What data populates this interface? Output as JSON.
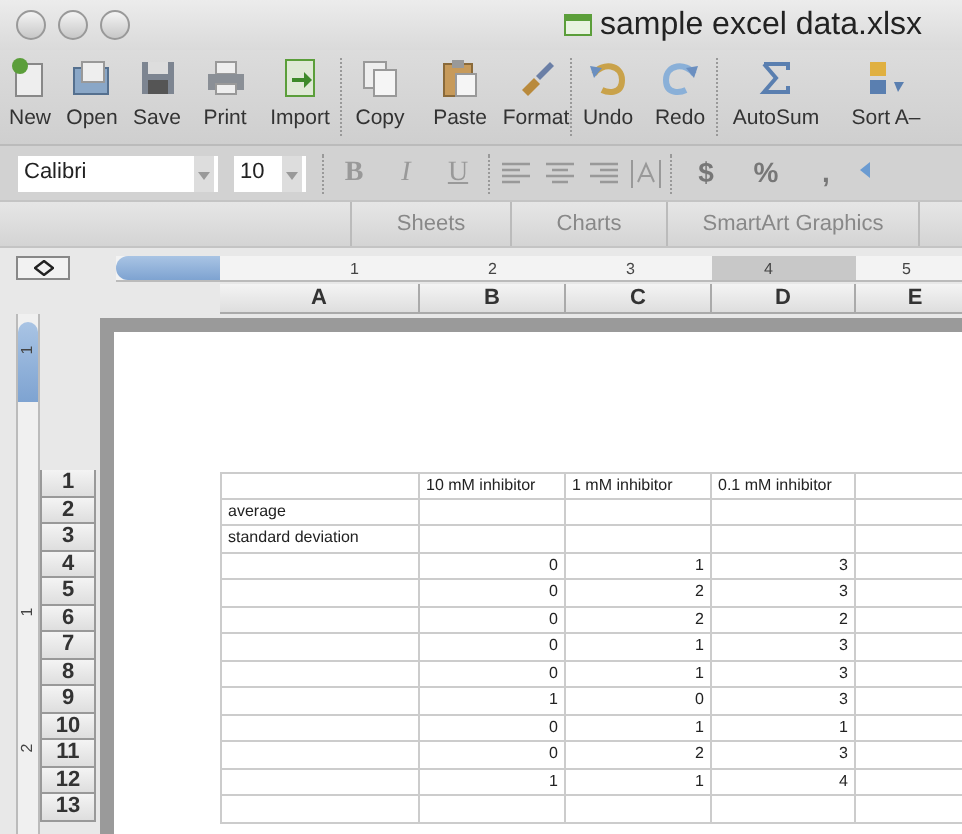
{
  "window": {
    "title": "sample excel data.xlsx"
  },
  "toolbar": [
    {
      "label": "New",
      "kind": "new"
    },
    {
      "label": "Open",
      "kind": "open"
    },
    {
      "label": "Save",
      "kind": "save"
    },
    {
      "label": "Print",
      "kind": "print"
    },
    {
      "label": "Import",
      "kind": "import"
    },
    {
      "label": "Copy",
      "kind": "copy"
    },
    {
      "label": "Paste",
      "kind": "paste"
    },
    {
      "label": "Format",
      "kind": "format"
    },
    {
      "label": "Undo",
      "kind": "undo"
    },
    {
      "label": "Redo",
      "kind": "redo"
    },
    {
      "label": "AutoSum",
      "kind": "autosum"
    },
    {
      "label": "Sort A–",
      "kind": "sort"
    }
  ],
  "format_bar": {
    "font": "Calibri",
    "size": "10",
    "styles": [
      "B",
      "I",
      "U"
    ],
    "number_formats": [
      "$",
      "%",
      ","
    ]
  },
  "ribbon_tabs": [
    "Sheets",
    "Charts",
    "SmartArt Graphics"
  ],
  "ruler": {
    "marks": [
      "1",
      "2",
      "3",
      "4",
      "5"
    ]
  },
  "vertical_ruler": {
    "marks": [
      "1",
      "1",
      "2"
    ]
  },
  "columns": [
    {
      "key": "A"
    },
    {
      "key": "B"
    },
    {
      "key": "C"
    },
    {
      "key": "D"
    },
    {
      "key": "E"
    }
  ],
  "rows": [
    {
      "number": "1",
      "B": "10 mM inhibitor",
      "C": "1 mM inhibitor",
      "D": "0.1 mM inhibitor"
    },
    {
      "number": "2",
      "A": "average"
    },
    {
      "number": "3",
      "A": "standard deviation"
    },
    {
      "number": "4",
      "B": "0",
      "C": "1",
      "D": "3"
    },
    {
      "number": "5",
      "B": "0",
      "C": "2",
      "D": "3"
    },
    {
      "number": "6",
      "B": "0",
      "C": "2",
      "D": "2"
    },
    {
      "number": "7",
      "B": "0",
      "C": "1",
      "D": "3"
    },
    {
      "number": "8",
      "B": "0",
      "C": "1",
      "D": "3"
    },
    {
      "number": "9",
      "B": "1",
      "C": "0",
      "D": "3"
    },
    {
      "number": "10",
      "B": "0",
      "C": "1",
      "D": "1"
    },
    {
      "number": "11",
      "B": "0",
      "C": "2",
      "D": "3"
    },
    {
      "number": "12",
      "B": "1",
      "C": "1",
      "D": "4"
    },
    {
      "number": "13"
    }
  ]
}
